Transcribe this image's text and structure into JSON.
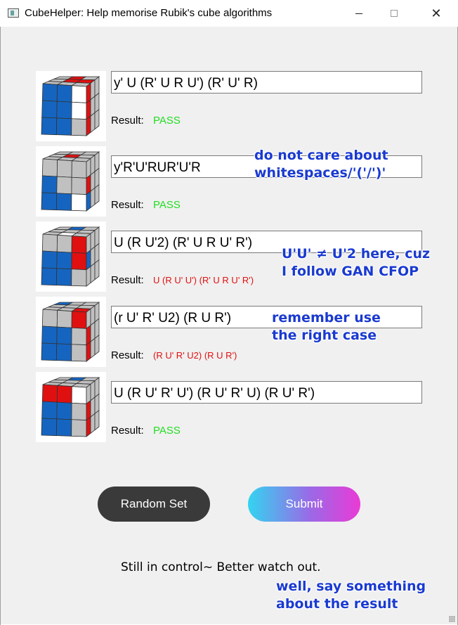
{
  "window": {
    "title": "CubeHelper: Help memorise Rubik's cube algorithms",
    "controls": {
      "minimize": "minimize",
      "maximize": "maximize",
      "close": "✕"
    }
  },
  "colors": {
    "red": "#e01010",
    "blue": "#1565c0",
    "gray": "#c0c0c0",
    "white": "#ffffff",
    "pass": "#22dd22",
    "annotation": "#1a3ad0"
  },
  "result_label": "Result:",
  "cases": [
    {
      "input": "y' U (R' U R U') (R' U' R)",
      "result": "PASS",
      "status": "pass",
      "top": [
        "g",
        "r",
        "g",
        "g",
        "r",
        "r",
        "g",
        "g",
        "g"
      ],
      "front": [
        "b",
        "b",
        "w",
        "b",
        "b",
        "w",
        "b",
        "b",
        "g"
      ],
      "right": [
        "r",
        "g",
        "g",
        "r",
        "g",
        "g",
        "r",
        "g",
        "g"
      ]
    },
    {
      "input": "y'R'U'RUR'U'R",
      "result": "PASS",
      "status": "pass",
      "top": [
        "g",
        "g",
        "g",
        "g",
        "r",
        "g",
        "g",
        "g",
        "g"
      ],
      "front": [
        "g",
        "g",
        "g",
        "b",
        "g",
        "g",
        "b",
        "b",
        "w"
      ],
      "right": [
        "g",
        "g",
        "g",
        "r",
        "g",
        "g",
        "b",
        "g",
        "g"
      ]
    },
    {
      "input": "U (R U'2) (R' U R U' R')",
      "result": "U (R U' U') (R' U R U' R')",
      "status": "fail",
      "top": [
        "g",
        "b",
        "g",
        "g",
        "g",
        "g",
        "g",
        "w",
        "g"
      ],
      "front": [
        "g",
        "g",
        "r",
        "b",
        "b",
        "r",
        "b",
        "b",
        "g"
      ],
      "right": [
        "g",
        "g",
        "g",
        "b",
        "g",
        "g",
        "g",
        "g",
        "g"
      ]
    },
    {
      "input": "(r U' R' U2) (R U R')",
      "result": "(R U' R' U2) (R U R')",
      "status": "fail",
      "top": [
        "b",
        "g",
        "g",
        "g",
        "g",
        "g",
        "g",
        "g",
        "r"
      ],
      "front": [
        "g",
        "g",
        "r",
        "b",
        "b",
        "g",
        "b",
        "b",
        "g"
      ],
      "right": [
        "g",
        "g",
        "g",
        "r",
        "g",
        "g",
        "r",
        "g",
        "g"
      ]
    },
    {
      "input": "U (R U' R' U') (R U' R' U) (R U' R')",
      "result": "PASS",
      "status": "pass",
      "top": [
        "g",
        "b",
        "g",
        "g",
        "g",
        "g",
        "g",
        "g",
        "g"
      ],
      "front": [
        "r",
        "r",
        "w",
        "b",
        "b",
        "g",
        "b",
        "b",
        "g"
      ],
      "right": [
        "g",
        "g",
        "g",
        "r",
        "g",
        "g",
        "r",
        "g",
        "g"
      ]
    }
  ],
  "annotations": {
    "a1": [
      "do not care about",
      "whitespaces/'('/')'"
    ],
    "a2": [
      "U'U' ≠ U'2 here, cuz",
      "I follow GAN CFOP"
    ],
    "a3": [
      "remember use",
      "the right case"
    ],
    "a4": [
      "well, say something",
      "about the result"
    ]
  },
  "buttons": {
    "random": "Random Set",
    "submit": "Submit"
  },
  "message": "Still in control~ Better watch out."
}
